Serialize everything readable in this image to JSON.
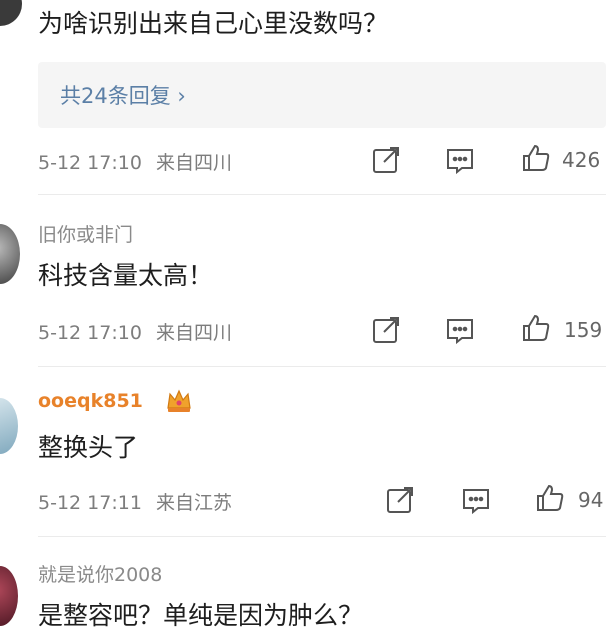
{
  "comments": [
    {
      "text": "为啥识别出来自己心里没数吗？",
      "replies_link": "共24条回复 ›",
      "date_time": "5-12 17:10",
      "location": "来自四川",
      "likes": "426"
    },
    {
      "username": "旧你或非门",
      "text": "科技含量太高！",
      "date_time": "5-12 17:10",
      "location": "来自四川",
      "likes": "159"
    },
    {
      "username": "ooeqk851",
      "text": "整换头了",
      "date_time": "5-12 17:11",
      "location": "来自江苏",
      "likes": "94"
    },
    {
      "username": "就是说你2008",
      "text": "是整容吧？单纯是因为肿么？"
    }
  ],
  "colors": {
    "link": "#5b7fa6",
    "vip_username": "#e8822a",
    "meta_text": "#7d7d7d",
    "reply_box_bg": "#f5f5f5"
  },
  "icons": [
    "share-icon",
    "comment-icon",
    "like-icon",
    "crown-badge-icon"
  ]
}
